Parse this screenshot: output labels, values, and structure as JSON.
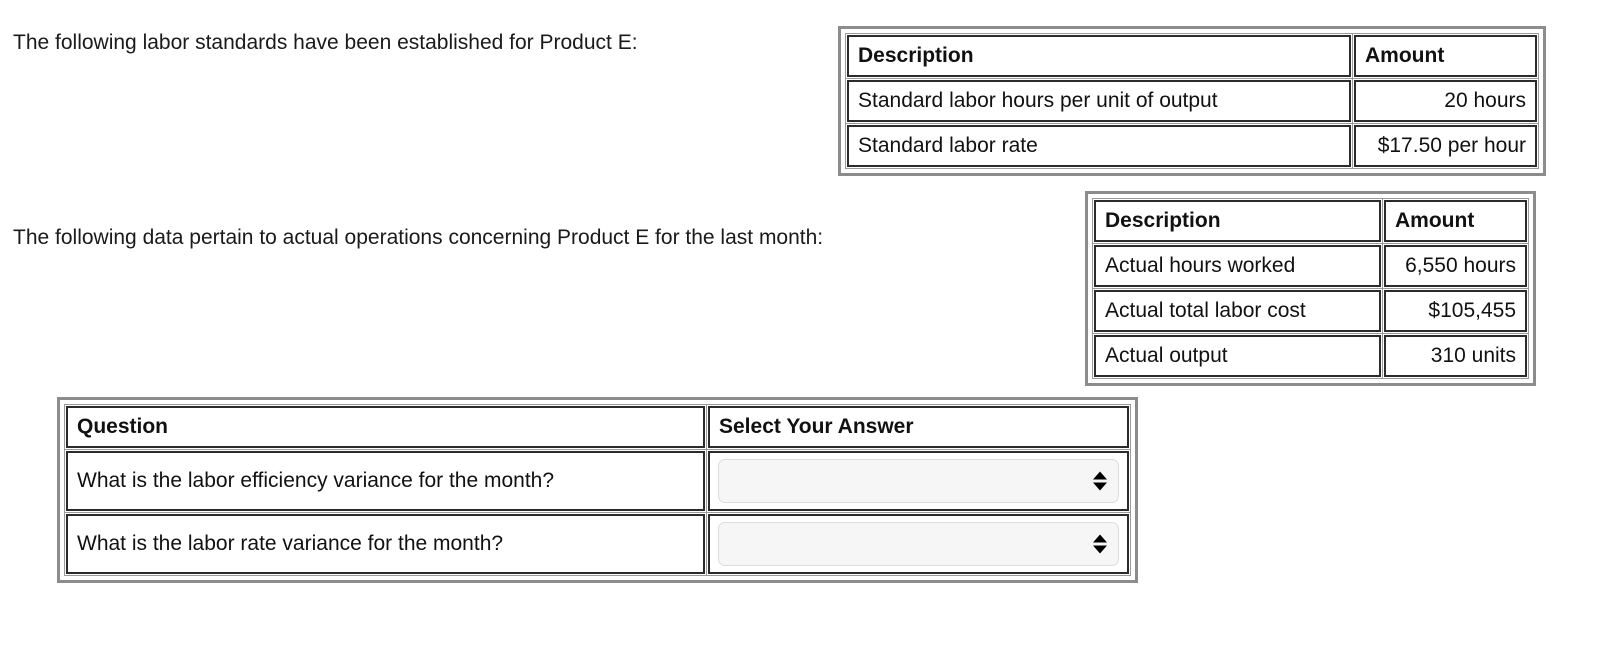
{
  "paragraphs": {
    "standards_intro": "The following labor standards have been established for Product E:",
    "actuals_intro": "The following data pertain to actual operations concerning Product E for the last month:"
  },
  "standards_table": {
    "headers": {
      "description": "Description",
      "amount": "Amount"
    },
    "rows": [
      {
        "description": "Standard labor hours per unit of output",
        "amount": "20 hours"
      },
      {
        "description": "Standard labor rate",
        "amount": "$17.50 per hour"
      }
    ]
  },
  "actuals_table": {
    "headers": {
      "description": "Description",
      "amount": "Amount"
    },
    "rows": [
      {
        "description": "Actual hours worked",
        "amount": "6,550 hours"
      },
      {
        "description": "Actual total labor cost",
        "amount": "$105,455"
      },
      {
        "description": "Actual output",
        "amount": "310 units"
      }
    ]
  },
  "questions_table": {
    "headers": {
      "question": "Question",
      "answer": "Select Your Answer"
    },
    "rows": [
      {
        "question": "What is the labor efficiency variance for the month?",
        "selected": ""
      },
      {
        "question": "What is the labor rate variance for the month?",
        "selected": ""
      }
    ]
  },
  "colors": {
    "text": "#1a1a1a",
    "cell_border": "#2b2b2b",
    "table_outer_border": "#8c8c8c",
    "select_background": "#f6f6f6"
  }
}
